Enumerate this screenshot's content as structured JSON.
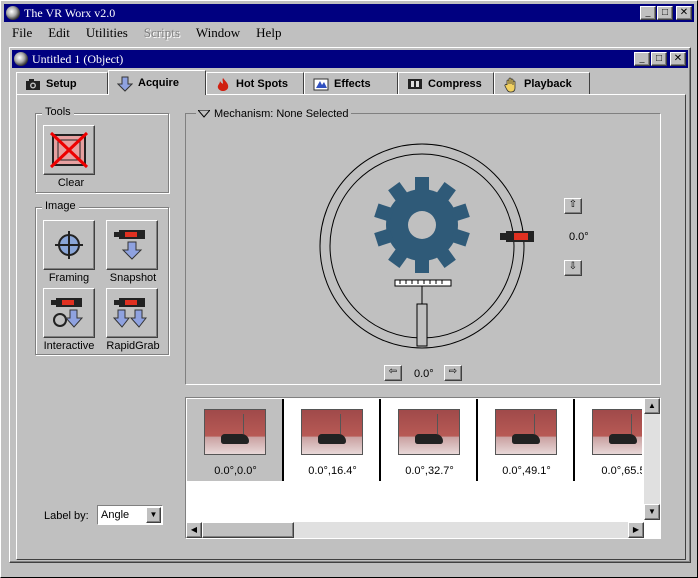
{
  "app": {
    "title": "The VR Worx v2.0"
  },
  "menu": [
    "File",
    "Edit",
    "Utilities",
    "Scripts",
    "Window",
    "Help"
  ],
  "doc": {
    "title": "Untitled 1 (Object)"
  },
  "tabs": [
    {
      "label": "Setup",
      "icon": "camera-icon"
    },
    {
      "label": "Acquire",
      "icon": "down-arrow-icon"
    },
    {
      "label": "Hot Spots",
      "icon": "flame-icon"
    },
    {
      "label": "Effects",
      "icon": "effects-icon"
    },
    {
      "label": "Compress",
      "icon": "film-icon"
    },
    {
      "label": "Playback",
      "icon": "hand-icon"
    }
  ],
  "tools": {
    "label": "Tools",
    "clear": "Clear"
  },
  "image": {
    "label": "Image",
    "framing": "Framing",
    "snapshot": "Snapshot",
    "interactive": "Interactive",
    "rapidgrab": "RapidGrab"
  },
  "mechanism": {
    "label": "Mechanism: None Selected",
    "tilt": "0.0°",
    "pan": "0.0°"
  },
  "thumbs": [
    "0.0°,0.0°",
    "0.0°,16.4°",
    "0.0°,32.7°",
    "0.0°,49.1°",
    "0.0°,65.5"
  ],
  "labelby": {
    "label": "Label by:",
    "value": "Angle"
  },
  "colors": {
    "titlebar": "#000080",
    "gear": "#2f5a78",
    "face": "#c0c0c0"
  }
}
